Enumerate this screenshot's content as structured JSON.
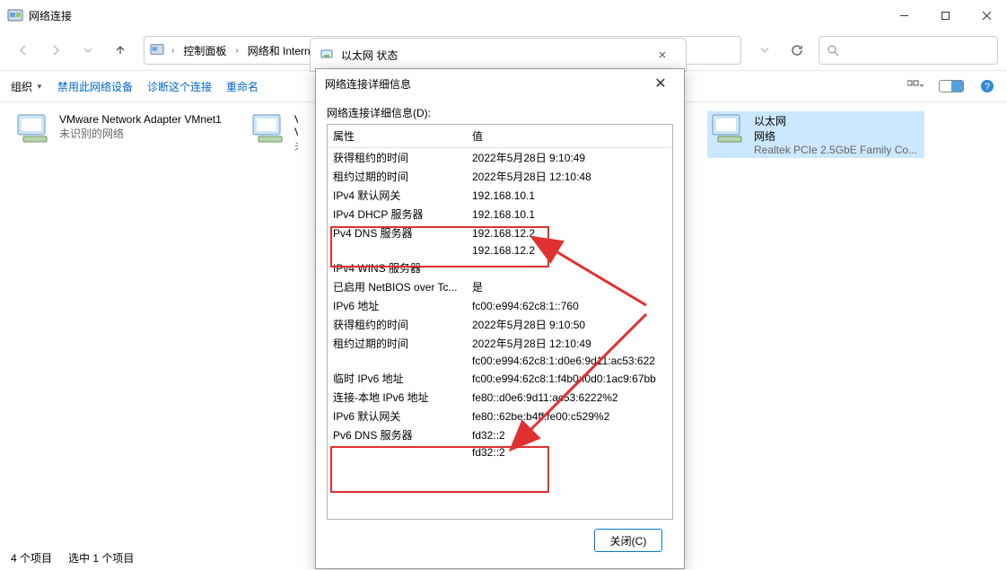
{
  "main": {
    "title": "网络连接",
    "nav": {
      "crumbs": [
        "控制面板",
        "网络和 Internet"
      ]
    },
    "search_placeholder": "",
    "cmdbar": {
      "organize": "组织",
      "disable": "禁用此网络设备",
      "diagnose": "诊断这个连接",
      "rename": "重命名"
    },
    "adapters": [
      {
        "title": "VMware Network Adapter VMnet1",
        "sub1": "",
        "sub2": "未识别的网络"
      },
      {
        "title": "VM",
        "sub1": "VM",
        "sub2": "未"
      },
      {
        "title": "以太网",
        "sub1": "网络",
        "sub2": "Realtek PCIe 2.5GbE Family Co..."
      }
    ],
    "status": {
      "count": "4 个项目",
      "selected": "选中 1 个项目"
    }
  },
  "dlg_status": {
    "title": "以太网 状态"
  },
  "dlg_details": {
    "title": "网络连接详细信息",
    "label": "网络连接详细信息(D):",
    "col_prop": "属性",
    "col_val": "值",
    "rows": [
      {
        "p": "获得租约的时间",
        "v": "2022年5月28日 9:10:49"
      },
      {
        "p": "租约过期的时间",
        "v": "2022年5月28日 12:10:48"
      },
      {
        "p": "IPv4 默认网关",
        "v": "192.168.10.1"
      },
      {
        "p": "IPv4 DHCP 服务器",
        "v": "192.168.10.1"
      },
      {
        "p": "Pv4 DNS 服务器",
        "v": "192.168.12.2"
      },
      {
        "p": "",
        "v": "192.168.12.2"
      },
      {
        "p": "IPv4 WINS 服务器",
        "v": ""
      },
      {
        "p": "已启用 NetBIOS over Tc...",
        "v": "是"
      },
      {
        "p": "IPv6 地址",
        "v": "fc00:e994:62c8:1::760"
      },
      {
        "p": "获得租约的时间",
        "v": "2022年5月28日 9:10:50"
      },
      {
        "p": "租约过期的时间",
        "v": "2022年5月28日 12:10:49"
      },
      {
        "p": "",
        "v": "fc00:e994:62c8:1:d0e6:9d11:ac53:622"
      },
      {
        "p": "临时 IPv6 地址",
        "v": "fc00:e994:62c8:1:f4b0:f0d0:1ac9:67bb"
      },
      {
        "p": "连接-本地 IPv6 地址",
        "v": "fe80::d0e6:9d11:ac53:6222%2"
      },
      {
        "p": "IPv6 默认网关",
        "v": "fe80::62be:b4ff:fe00:c529%2"
      },
      {
        "p": "Pv6 DNS 服务器",
        "v": "fd32::2"
      },
      {
        "p": "",
        "v": "fd32::2"
      }
    ],
    "close_btn": "关闭(C)"
  }
}
